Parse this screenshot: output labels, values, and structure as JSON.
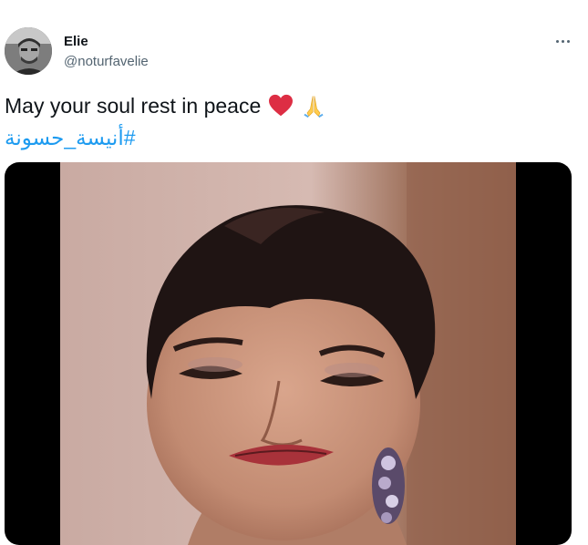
{
  "author": {
    "name": "Elie",
    "handle": "@noturfavelie",
    "avatar_icon": "profile-photo"
  },
  "tweet": {
    "text": "May your soul rest in peace",
    "emojis": [
      "red-heart-icon",
      "folded-hands-icon"
    ],
    "hashtag": "#أنيسة_حسونة"
  },
  "menu": {
    "icon": "more-options-icon"
  },
  "media": {
    "type": "video",
    "background": "#000000"
  },
  "colors": {
    "link": "#1d9bf0",
    "secondary_text": "#536471",
    "primary_text": "#0f1419"
  }
}
